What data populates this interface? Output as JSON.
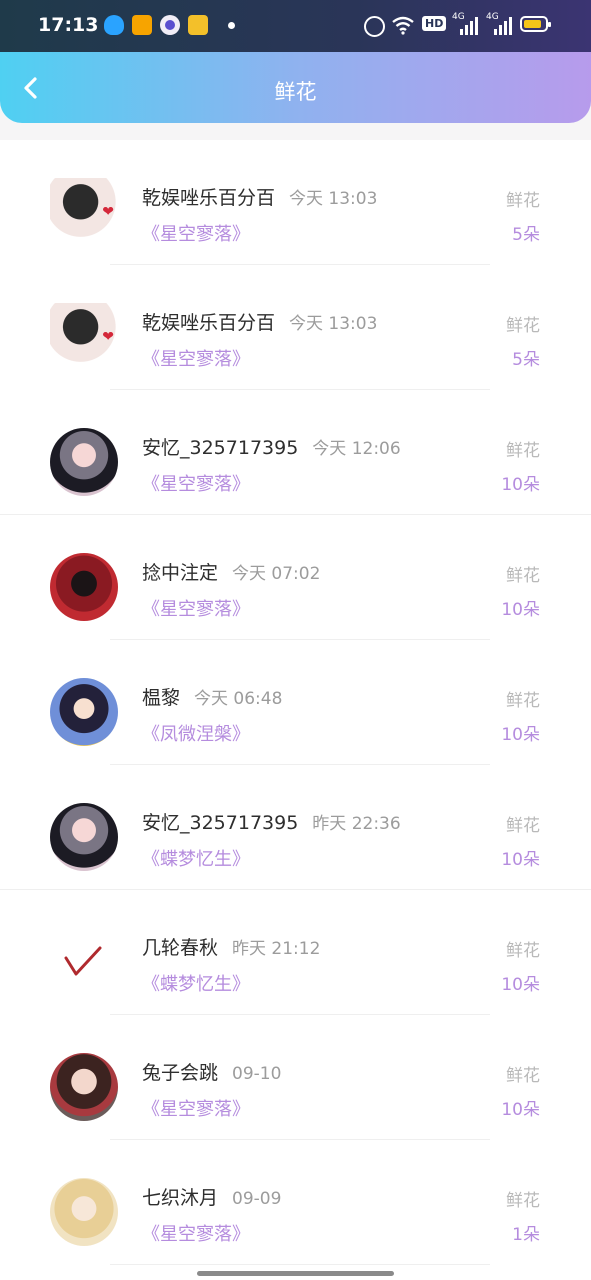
{
  "status_bar": {
    "time": "17:13",
    "hd_label": "HD",
    "network": "4G"
  },
  "header": {
    "title": "鲜花"
  },
  "gift_label": "鲜花",
  "records": [
    {
      "name": "乾娱唑乐百分百",
      "time": "今天 13:03",
      "channel": "《星空寥落》",
      "count": "5朵",
      "avatar": "girl-photo"
    },
    {
      "name": "乾娱唑乐百分百",
      "time": "今天 13:03",
      "channel": "《星空寥落》",
      "count": "5朵",
      "avatar": "girl-photo"
    },
    {
      "name": "安忆_325717395",
      "time": "今天 12:06",
      "channel": "《星空寥落》",
      "count": "10朵",
      "avatar": "anime-grey-hair"
    },
    {
      "name": "捻中注定",
      "time": "今天 07:02",
      "channel": "《星空寥落》",
      "count": "10朵",
      "avatar": "anime-red"
    },
    {
      "name": "榅黎",
      "time": "今天 06:48",
      "channel": "《凤微涅槃》",
      "count": "10朵",
      "avatar": "anime-glasses"
    },
    {
      "name": "安忆_325717395",
      "time": "昨天 22:36",
      "channel": "《蝶梦忆生》",
      "count": "10朵",
      "avatar": "anime-grey-hair"
    },
    {
      "name": "几轮春秋",
      "time": "昨天 21:12",
      "channel": "《蝶梦忆生》",
      "count": "10朵",
      "avatar": "checkmark-drawing"
    },
    {
      "name": "兔子会跳",
      "time": "09-10",
      "channel": "《星空寥落》",
      "count": "10朵",
      "avatar": "anime-rose"
    },
    {
      "name": "七织沐月",
      "time": "09-09",
      "channel": "《星空寥落》",
      "count": "1朵",
      "avatar": "anime-blonde"
    }
  ],
  "colors": {
    "accent_purple": "#b58cde",
    "header_start": "#4fd0f2",
    "header_end": "#b79bec"
  }
}
